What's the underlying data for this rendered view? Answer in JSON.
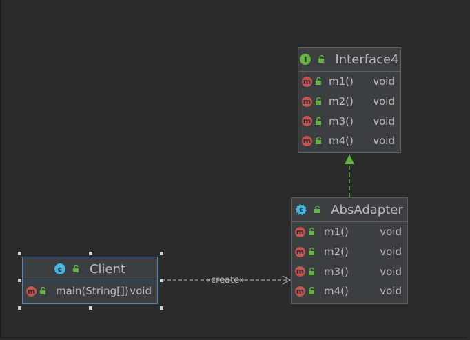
{
  "interface4": {
    "name": "Interface4",
    "kind_icon": "interface-icon",
    "methods": [
      {
        "name": "m1()",
        "type": "void"
      },
      {
        "name": "m2()",
        "type": "void"
      },
      {
        "name": "m3()",
        "type": "void"
      },
      {
        "name": "m4()",
        "type": "void"
      }
    ]
  },
  "absadapter": {
    "name": "AbsAdapter",
    "kind_icon": "abstract-class-icon",
    "methods": [
      {
        "name": "m1()",
        "type": "void"
      },
      {
        "name": "m2()",
        "type": "void"
      },
      {
        "name": "m3()",
        "type": "void"
      },
      {
        "name": "m4()",
        "type": "void"
      }
    ]
  },
  "client": {
    "name": "Client",
    "kind_icon": "class-icon",
    "methods": [
      {
        "name": "main(String[])",
        "type": "void"
      }
    ]
  },
  "edges": {
    "create_label": "«create»"
  },
  "colors": {
    "background": "#2b2b2b",
    "node_fill": "#3c3f41",
    "selection": "#4a88c7",
    "realization_arrow": "#62b543",
    "method_icon": "#c75450"
  }
}
